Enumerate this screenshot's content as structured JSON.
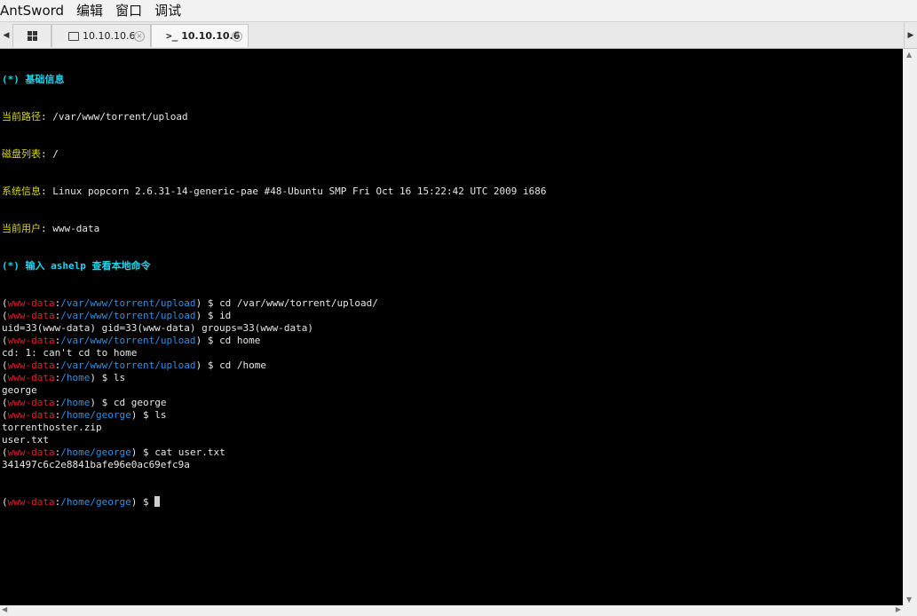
{
  "menubar": {
    "items": [
      "AntSword",
      "编辑",
      "窗口",
      "调试"
    ]
  },
  "tabs": {
    "home_icon": "grid-icon",
    "tab1": {
      "label": "10.10.10.6",
      "close": "×"
    },
    "tab2": {
      "label": "10.10.10.6",
      "prefix": ">_",
      "close": "×"
    }
  },
  "terminal": {
    "info_header": "(*) 基础信息",
    "info": [
      {
        "k": "当前路径",
        "v": ": /var/www/torrent/upload"
      },
      {
        "k": "磁盘列表",
        "v": ": /"
      },
      {
        "k": "系统信息",
        "v": ": Linux popcorn 2.6.31-14-generic-pae #48-Ubuntu SMP Fri Oct 16 15:22:42 UTC 2009 i686"
      },
      {
        "k": "当前用户",
        "v": ": www-data"
      }
    ],
    "help_line": "(*) 输入 ashelp 查看本地命令",
    "user": "www-data",
    "entries": [
      {
        "path": "/var/www/torrent/upload",
        "cmd": "cd /var/www/torrent/upload/",
        "out": []
      },
      {
        "path": "/var/www/torrent/upload",
        "cmd": "id",
        "out": [
          "uid=33(www-data) gid=33(www-data) groups=33(www-data)"
        ]
      },
      {
        "path": "/var/www/torrent/upload",
        "cmd": "cd home",
        "out": [
          "cd: 1: can't cd to home"
        ]
      },
      {
        "path": "/var/www/torrent/upload",
        "cmd": "cd /home",
        "out": []
      },
      {
        "path": "/home",
        "cmd": "ls",
        "out": [
          "george"
        ]
      },
      {
        "path": "/home",
        "cmd": "cd george",
        "out": []
      },
      {
        "path": "/home/george",
        "cmd": "ls",
        "out": [
          "torrenthoster.zip",
          "user.txt"
        ]
      },
      {
        "path": "/home/george",
        "cmd": "cat user.txt",
        "out": [
          "341497c6c2e8841bafe96e0ac69efc9a"
        ]
      }
    ],
    "current_path": "/home/george",
    "prompt_symbol": "$"
  }
}
